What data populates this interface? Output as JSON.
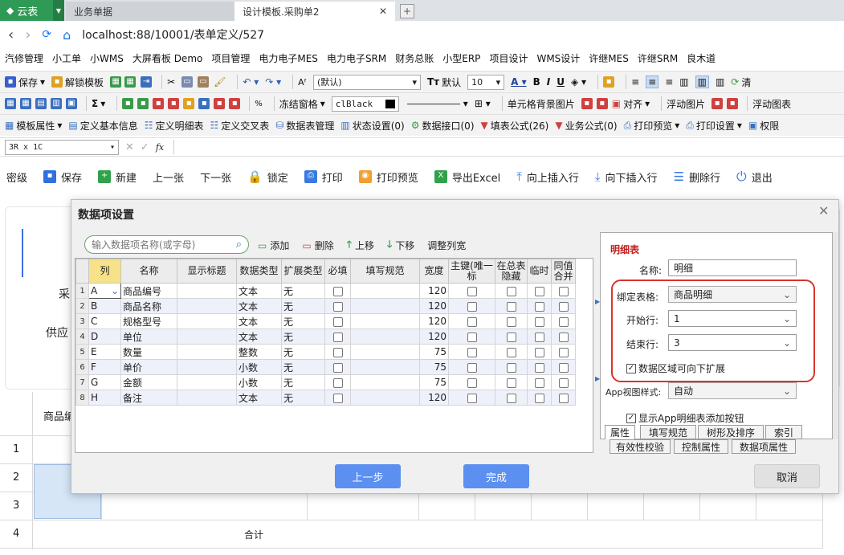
{
  "tabs": {
    "brand": "云表",
    "tab1": "业务单据",
    "tab2": "设计模板.采购单2",
    "new_tab": "+"
  },
  "address": {
    "url": "localhost:88/10001/表单定义/527"
  },
  "bookmarks": [
    "汽修管理",
    "小工单",
    "小WMS",
    "大屏看板 Demo",
    "项目管理",
    "电力电子MES",
    "电力电子SRM",
    "财务总账",
    "小型ERP",
    "项目设计",
    "WMS设计",
    "许继MES",
    "许继SRM",
    "良木道"
  ],
  "toolbar1": {
    "save": "保存",
    "unlock": "解锁模板",
    "font_name": "(默认)",
    "font_default": "默认",
    "font_size": "10",
    "clear": "清"
  },
  "toolbar2": {
    "sigma": "Σ",
    "freeze": "冻结窗格",
    "color_name": "clBlack",
    "cell_bg": "单元格背景图片",
    "align": "对齐",
    "float_img": "浮动图片",
    "float_chart": "浮动图表"
  },
  "toolbar3": {
    "items": [
      "模板属性",
      "定义基本信息",
      "定义明细表",
      "定义交叉表",
      "数据表管理",
      "状态设置(0)",
      "数据接口(0)",
      "填表公式(26)",
      "业务公式(0)",
      "打印预览",
      "打印设置",
      "权限"
    ]
  },
  "formula": {
    "cell_ref": "3R x 1C",
    "fx": "fx"
  },
  "actions": [
    "密级",
    "保存",
    "新建",
    "上一张",
    "下一张",
    "锁定",
    "打印",
    "打印预览",
    "导出Excel",
    "向上插入行",
    "向下插入行",
    "删除行",
    "退出"
  ],
  "background": {
    "label1": "采",
    "label2": "供应",
    "col_header": "商品编",
    "row_numbers": [
      "1",
      "2",
      "3",
      "4"
    ],
    "total": "合计"
  },
  "dialog": {
    "title": "数据项设置",
    "search_placeholder": "输入数据项名称(或字母)",
    "tools": [
      "添加",
      "删除",
      "上移",
      "下移",
      "调整列宽"
    ],
    "headers": [
      "列",
      "名称",
      "显示标题",
      "数据类型",
      "扩展类型",
      "必填",
      "填写规范",
      "宽度",
      "主键(唯一标",
      "在总表隐藏",
      "临时",
      "同值合并"
    ],
    "rows": [
      {
        "n": "1",
        "col": "A",
        "name": "商品编号",
        "type": "文本",
        "ext": "无",
        "width": "120"
      },
      {
        "n": "2",
        "col": "B",
        "name": "商品名称",
        "type": "文本",
        "ext": "无",
        "width": "120"
      },
      {
        "n": "3",
        "col": "C",
        "name": "规格型号",
        "type": "文本",
        "ext": "无",
        "width": "120"
      },
      {
        "n": "4",
        "col": "D",
        "name": "单位",
        "type": "文本",
        "ext": "无",
        "width": "120"
      },
      {
        "n": "5",
        "col": "E",
        "name": "数量",
        "type": "整数",
        "ext": "无",
        "width": "75"
      },
      {
        "n": "6",
        "col": "F",
        "name": "单价",
        "type": "小数",
        "ext": "无",
        "width": "75"
      },
      {
        "n": "7",
        "col": "G",
        "name": "金额",
        "type": "小数",
        "ext": "无",
        "width": "75"
      },
      {
        "n": "8",
        "col": "H",
        "name": "备注",
        "type": "文本",
        "ext": "无",
        "width": "120"
      }
    ],
    "panel": {
      "title": "明细表",
      "name_label": "名称:",
      "name_value": "明细",
      "bind_label": "绑定表格:",
      "bind_value": "商品明细",
      "start_label": "开始行:",
      "start_value": "1",
      "end_label": "结束行:",
      "end_value": "3",
      "expand_label": "数据区域可向下扩展",
      "app_style_label": "App视图样式:",
      "app_style_value": "自动",
      "app_button_label": "显示App明细表添加按钮",
      "tabs_row1": [
        "属性",
        "填写规范",
        "树形及排序",
        "索引"
      ],
      "tabs_row2": [
        "有效性校验",
        "控制属性",
        "数据项属性"
      ]
    },
    "buttons": {
      "prev": "上一步",
      "finish": "完成",
      "cancel": "取消"
    }
  },
  "colors": {
    "brand_green": "#2e9a55",
    "accent_blue": "#5b8ff0",
    "highlight_red": "#d9332b"
  }
}
